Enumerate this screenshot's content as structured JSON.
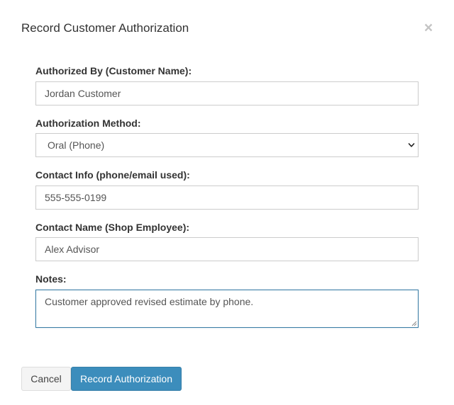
{
  "modal": {
    "title": "Record Customer Authorization",
    "close_glyph": "×"
  },
  "form": {
    "authorized_by": {
      "label": "Authorized By (Customer Name):",
      "value": "Jordan Customer"
    },
    "method": {
      "label": "Authorization Method:",
      "selected": "Oral (Phone)"
    },
    "contact_info": {
      "label": "Contact Info (phone/email used):",
      "value": "555-555-0199"
    },
    "contact_name": {
      "label": "Contact Name (Shop Employee):",
      "value": "Alex Advisor"
    },
    "notes": {
      "label": "Notes:",
      "value": "Customer approved revised estimate by phone."
    }
  },
  "footer": {
    "cancel_label": "Cancel",
    "submit_label": "Record Authorization"
  },
  "colors": {
    "primary": "#3c8dbc",
    "focus_border": "#3c7ea6",
    "default_button": "#f4f4f4"
  },
  "icons": {
    "close": "close-icon",
    "select": "chevron-down-icon",
    "resize": "resize-grip-icon"
  }
}
